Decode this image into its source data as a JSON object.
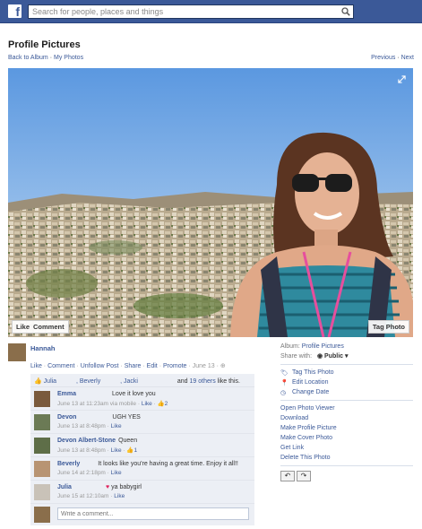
{
  "colors": {
    "brand": "#3b5998",
    "feedback_bg": "#eceff5"
  },
  "header": {
    "logo": "f",
    "search_placeholder": "Search for people, places and things"
  },
  "page": {
    "title": "Profile Pictures",
    "back_link": "Back to Album",
    "sep": "·",
    "my_photos": "My Photos",
    "previous": "Previous",
    "next": "Next"
  },
  "photo": {
    "like_label": "Like",
    "comment_label": "Comment",
    "tag_label": "Tag Photo"
  },
  "owner": {
    "name": "Hannah",
    "actions": [
      "Like",
      "Comment",
      "Unfollow Post",
      "Share",
      "Edit",
      "Promote"
    ],
    "date": "June 13"
  },
  "likes": {
    "names": [
      "Julia",
      ", Beverly",
      ", Jacki"
    ],
    "and_text": "and",
    "others_link": "19 others",
    "suffix": "like this."
  },
  "comments": [
    {
      "name": "Emma",
      "text": "Love it love you",
      "meta": "June 13 at 11:23am via mobile",
      "like": "Like",
      "likes": "2"
    },
    {
      "name": "Devon",
      "text": "UGH YES",
      "meta": "June 13 at 8:48pm",
      "like": "Like",
      "likes": ""
    },
    {
      "name": "Devon Albert-Stone",
      "text": "Queen",
      "meta": "June 13 at 8:48pm",
      "like": "Like",
      "likes": "1"
    },
    {
      "name": "Beverly",
      "text": "It looks like you're having a great time. Enjoy it all!!",
      "meta": "June 14 at 2:18pm",
      "like": "Like",
      "likes": ""
    },
    {
      "name": "Julia",
      "text": "ya babygirl",
      "meta": "June 15 at 12:10am",
      "like": "Like",
      "likes": ""
    }
  ],
  "write_placeholder": "Write a comment...",
  "sidebar": {
    "album_label": "Album:",
    "album_link": "Profile Pictures",
    "share_label": "Share with:",
    "share_value": "Public",
    "icon_links": [
      "Tag This Photo",
      "Edit Location",
      "Change Date"
    ],
    "links": [
      "Open Photo Viewer",
      "Download",
      "Make Profile Picture",
      "Make Cover Photo",
      "Get Link",
      "Delete This Photo"
    ]
  }
}
